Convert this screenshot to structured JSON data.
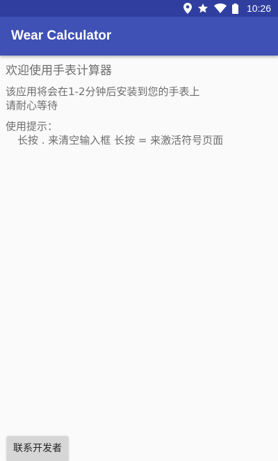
{
  "status_bar": {
    "time": "10:26",
    "icons": [
      "location-icon",
      "star-icon",
      "wifi-icon",
      "battery-icon"
    ]
  },
  "app_bar": {
    "title": "Wear Calculator",
    "color": "#3f51b5",
    "status_color": "#303f9f"
  },
  "content": {
    "welcome": "欢迎使用手表计算器",
    "notice_line1": "该应用将会在1-2分钟后安装到您的手表上",
    "notice_line2": "请耐心等待",
    "tips_title": "使用提示：",
    "tips_body": "长按 . 来清空输入框 长按 = 来激活符号页面"
  },
  "contact_button": {
    "label": "联系开发者"
  }
}
